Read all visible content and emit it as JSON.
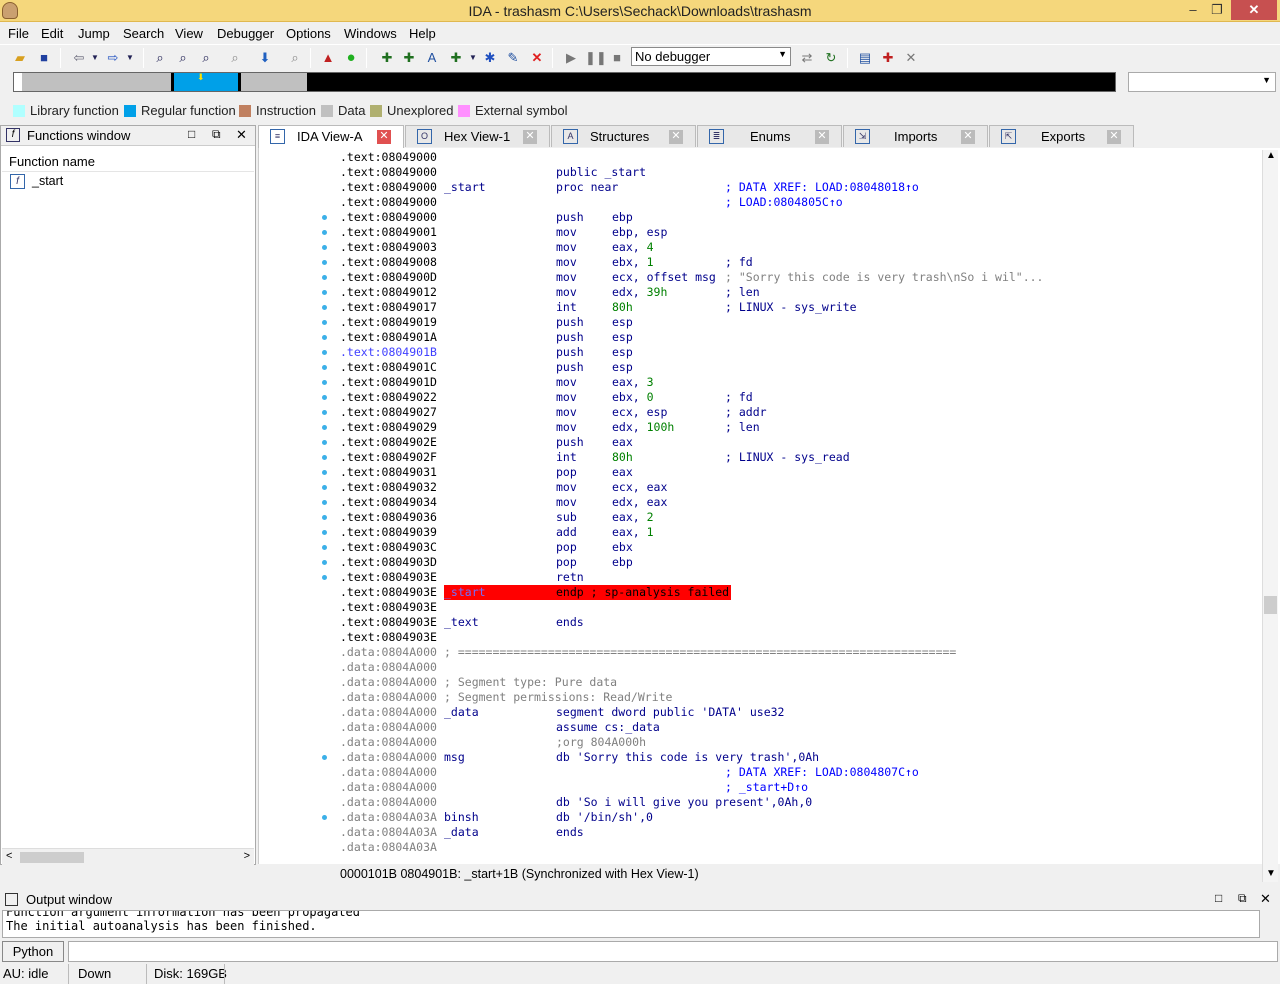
{
  "window": {
    "title": "IDA - trashasm C:\\Users\\Sechack\\Downloads\\trashasm"
  },
  "menu": [
    "File",
    "Edit",
    "Jump",
    "Search",
    "View",
    "Debugger",
    "Options",
    "Windows",
    "Help"
  ],
  "debugger_select": "No debugger",
  "legend": [
    {
      "label": "Library function",
      "color": "#b0ffff"
    },
    {
      "label": "Regular function",
      "color": "#00a0e8"
    },
    {
      "label": "Instruction",
      "color": "#c08060"
    },
    {
      "label": "Data",
      "color": "#c0c0c0"
    },
    {
      "label": "Unexplored",
      "color": "#b0b070"
    },
    {
      "label": "External symbol",
      "color": "#ff90ff"
    }
  ],
  "functions_window": {
    "title": "Functions window",
    "column": "Function name",
    "items": [
      "_start"
    ]
  },
  "tabs": [
    "IDA View-A",
    "Hex View-1",
    "Structures",
    "Enums",
    "Imports",
    "Exports"
  ],
  "code": [
    {
      "a": ".text:08049000",
      "l": "",
      "m": "",
      "o": "",
      "c": ""
    },
    {
      "a": ".text:08049000",
      "l": "",
      "m": "public _start",
      "o": "",
      "c": ""
    },
    {
      "a": ".text:08049000",
      "l": "_start",
      "m": "proc near",
      "o": "",
      "c": "; DATA XREF: LOAD:08048018↑o"
    },
    {
      "a": ".text:08049000",
      "l": "",
      "m": "",
      "o": "",
      "c": "; LOAD:0804805C↑o"
    },
    {
      "a": ".text:08049000",
      "l": "",
      "m": "push",
      "o": "ebp",
      "c": ""
    },
    {
      "a": ".text:08049001",
      "l": "",
      "m": "mov",
      "o": "ebp, esp",
      "c": ""
    },
    {
      "a": ".text:08049003",
      "l": "",
      "m": "mov",
      "o": "eax, 4",
      "c": ""
    },
    {
      "a": ".text:08049008",
      "l": "",
      "m": "mov",
      "o": "ebx, 1",
      "c": "; fd"
    },
    {
      "a": ".text:0804900D",
      "l": "",
      "m": "mov",
      "o": "ecx, offset msg",
      "c": "; \"Sorry this code is very trash\\nSo i wil\"..."
    },
    {
      "a": ".text:08049012",
      "l": "",
      "m": "mov",
      "o": "edx, 39h",
      "c": "; len"
    },
    {
      "a": ".text:08049017",
      "l": "",
      "m": "int",
      "o": "80h",
      "c": "; LINUX - sys_write"
    },
    {
      "a": ".text:08049019",
      "l": "",
      "m": "push",
      "o": "esp",
      "c": ""
    },
    {
      "a": ".text:0804901A",
      "l": "",
      "m": "push",
      "o": "esp",
      "c": ""
    },
    {
      "a": ".text:0804901B",
      "l": "",
      "m": "push",
      "o": "esp",
      "c": ""
    },
    {
      "a": ".text:0804901C",
      "l": "",
      "m": "push",
      "o": "esp",
      "c": ""
    },
    {
      "a": ".text:0804901D",
      "l": "",
      "m": "mov",
      "o": "eax, 3",
      "c": ""
    },
    {
      "a": ".text:08049022",
      "l": "",
      "m": "mov",
      "o": "ebx, 0",
      "c": "; fd"
    },
    {
      "a": ".text:08049027",
      "l": "",
      "m": "mov",
      "o": "ecx, esp",
      "c": "; addr"
    },
    {
      "a": ".text:08049029",
      "l": "",
      "m": "mov",
      "o": "edx, 100h",
      "c": "; len"
    },
    {
      "a": ".text:0804902E",
      "l": "",
      "m": "push",
      "o": "eax",
      "c": ""
    },
    {
      "a": ".text:0804902F",
      "l": "",
      "m": "int",
      "o": "80h",
      "c": "; LINUX - sys_read"
    },
    {
      "a": ".text:08049031",
      "l": "",
      "m": "pop",
      "o": "eax",
      "c": ""
    },
    {
      "a": ".text:08049032",
      "l": "",
      "m": "mov",
      "o": "ecx, eax",
      "c": ""
    },
    {
      "a": ".text:08049034",
      "l": "",
      "m": "mov",
      "o": "edx, eax",
      "c": ""
    },
    {
      "a": ".text:08049036",
      "l": "",
      "m": "sub",
      "o": "eax, 2",
      "c": ""
    },
    {
      "a": ".text:08049039",
      "l": "",
      "m": "add",
      "o": "eax, 1",
      "c": ""
    },
    {
      "a": ".text:0804903C",
      "l": "",
      "m": "pop",
      "o": "ebx",
      "c": ""
    },
    {
      "a": ".text:0804903D",
      "l": "",
      "m": "pop",
      "o": "ebp",
      "c": ""
    },
    {
      "a": ".text:0804903E",
      "l": "",
      "m": "retn",
      "o": "",
      "c": ""
    },
    {
      "a": ".text:0804903E",
      "l": "_start",
      "m": "endp ; sp-analysis failed",
      "o": "",
      "c": ""
    },
    {
      "a": ".text:0804903E",
      "l": "",
      "m": "",
      "o": "",
      "c": ""
    },
    {
      "a": ".text:0804903E",
      "l": "_text",
      "m": "ends",
      "o": "",
      "c": ""
    },
    {
      "a": ".text:0804903E",
      "l": "",
      "m": "",
      "o": "",
      "c": ""
    },
    {
      "a": ".data:0804A000",
      "l": "; ========================================================================",
      "m": "",
      "o": "",
      "c": ""
    },
    {
      "a": ".data:0804A000",
      "l": "",
      "m": "",
      "o": "",
      "c": ""
    },
    {
      "a": ".data:0804A000",
      "l": "; Segment type: Pure data",
      "m": "",
      "o": "",
      "c": ""
    },
    {
      "a": ".data:0804A000",
      "l": "; Segment permissions: Read/Write",
      "m": "",
      "o": "",
      "c": ""
    },
    {
      "a": ".data:0804A000",
      "l": "_data",
      "m": "segment dword public 'DATA' use32",
      "o": "",
      "c": ""
    },
    {
      "a": ".data:0804A000",
      "l": "",
      "m": "assume cs:_data",
      "o": "",
      "c": ""
    },
    {
      "a": ".data:0804A000",
      "l": "",
      "m": ";org 804A000h",
      "o": "",
      "c": ""
    },
    {
      "a": ".data:0804A000",
      "l": "msg",
      "m": "db 'Sorry this code is very trash',0Ah",
      "o": "",
      "c": ""
    },
    {
      "a": ".data:0804A000",
      "l": "",
      "m": "",
      "o": "",
      "c": "; DATA XREF: LOAD:0804807C↑o"
    },
    {
      "a": ".data:0804A000",
      "l": "",
      "m": "",
      "o": "",
      "c": "; _start+D↑o"
    },
    {
      "a": ".data:0804A000",
      "l": "",
      "m": "db 'So i will give you present',0Ah,0",
      "o": "",
      "c": ""
    },
    {
      "a": ".data:0804A03A",
      "l": "binsh",
      "m": "db '/bin/sh',0",
      "o": "",
      "c": ""
    },
    {
      "a": ".data:0804A03A",
      "l": "_data",
      "m": "ends",
      "o": "",
      "c": ""
    },
    {
      "a": ".data:0804A03A",
      "l": "",
      "m": "",
      "o": "",
      "c": ""
    }
  ],
  "view_status": "0000101B 0804901B: _start+1B (Synchronized with Hex View-1)",
  "output_window": {
    "title": "Output window",
    "lines": [
      "Function argument information has been propagated",
      "The initial autoanalysis has been finished."
    ]
  },
  "python_button": "Python",
  "statusbar": {
    "au": "AU:  idle",
    "dir": "Down",
    "disk": "Disk: 169GB"
  }
}
